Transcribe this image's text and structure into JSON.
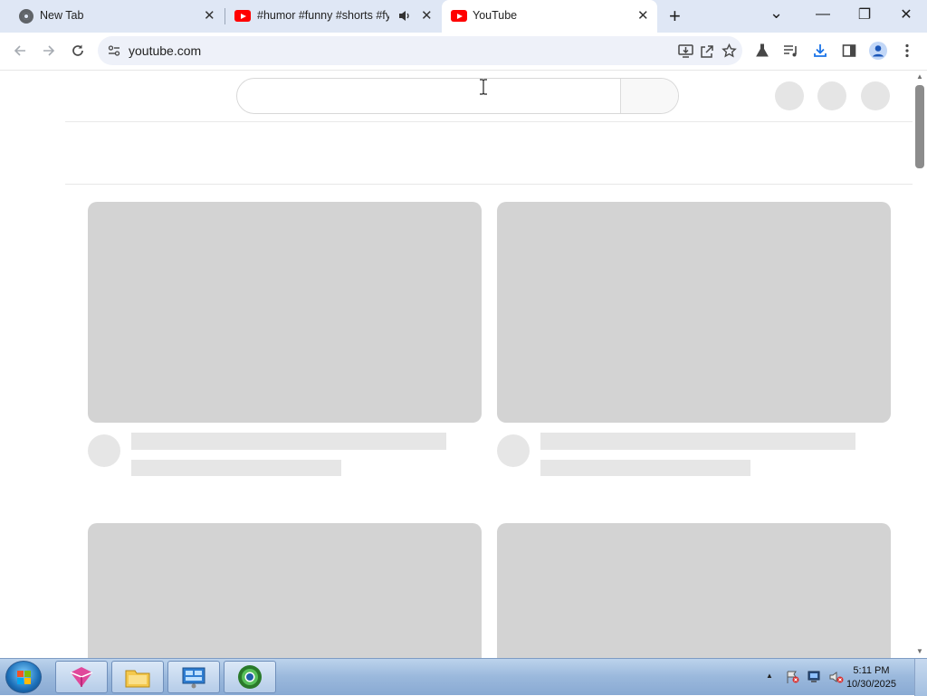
{
  "browser": {
    "tabs": [
      {
        "title": "New Tab",
        "favicon": "chrome-icon",
        "active": false
      },
      {
        "title": "#humor #funny #shorts #fy",
        "favicon": "youtube-icon",
        "active": false,
        "audio": true
      },
      {
        "title": "YouTube",
        "favicon": "youtube-icon",
        "active": true
      }
    ],
    "new_tab_symbol": "+",
    "tab_search_symbol": "⌄",
    "window_controls": {
      "minimize": "—",
      "restore": "❐",
      "close": "✕"
    },
    "address": "youtube.com",
    "toolbar_icons": [
      "back-icon",
      "forward-icon",
      "reload-icon",
      "site-info-icon",
      "install-app-icon",
      "share-icon",
      "bookmark-star-icon",
      "labs-flask-icon",
      "reading-list-icon",
      "download-icon",
      "side-panel-icon",
      "profile-icon",
      "menu-icon"
    ]
  },
  "page": {
    "state": "loading-skeleton",
    "search_placeholder": ""
  },
  "taskbar": {
    "time": "5:11 PM",
    "date": "10/30/2025",
    "pinned": [
      "start-orb",
      "paint-app-icon",
      "file-explorer-icon",
      "control-panel-icon",
      "chrome-browser-icon"
    ],
    "tray_expand": "▲"
  },
  "colors": {
    "tabstrip_bg": "#dfe7f5",
    "omnibox_bg": "#eef1f9",
    "skeleton": "#d3d3d3",
    "youtube_red": "#ff0000",
    "taskbar": "#9ab8dc"
  }
}
